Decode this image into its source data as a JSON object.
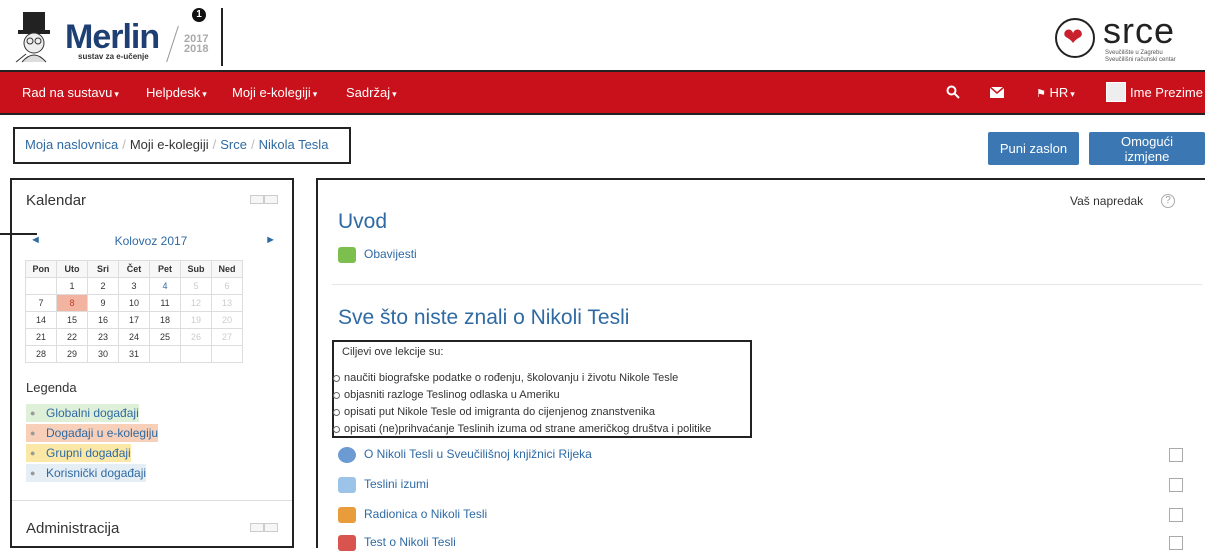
{
  "header": {
    "logo_title": "Merlin",
    "logo_subtitle": "sustav za e-učenje",
    "logo_year": "2017\n2018",
    "badge": "1",
    "partner_name": "srce",
    "partner_sub": "Sveučilište u Zagrebu\nSveučilišni računski centar"
  },
  "navbar": {
    "items": [
      {
        "label": "Rad na sustavu"
      },
      {
        "label": "Helpdesk"
      },
      {
        "label": "Moji e-kolegiji"
      },
      {
        "label": "Sadržaj"
      }
    ],
    "language": "HR",
    "user_name": "Ime Prezime",
    "bg_color": "#c9111b"
  },
  "breadcrumb": {
    "items": [
      "Moja naslovnica",
      "Moji e-kolegiji",
      "Srce",
      "Nikola Tesla"
    ]
  },
  "buttons": {
    "fullscreen": "Puni zaslon",
    "edit": "Omogući izmjene"
  },
  "calendar": {
    "title": "Kalendar",
    "month": "Kolovoz 2017",
    "weekdays": [
      "Pon",
      "Uto",
      "Sri",
      "Čet",
      "Pet",
      "Sub",
      "Ned"
    ],
    "weeks": [
      [
        "",
        "1",
        "2",
        "3",
        "4",
        "5",
        "6"
      ],
      [
        "7",
        "8",
        "9",
        "10",
        "11",
        "12",
        "13"
      ],
      [
        "14",
        "15",
        "16",
        "17",
        "18",
        "19",
        "20"
      ],
      [
        "21",
        "22",
        "23",
        "24",
        "25",
        "26",
        "27"
      ],
      [
        "28",
        "29",
        "30",
        "31",
        "",
        "",
        ""
      ]
    ],
    "today": "8",
    "legend_title": "Legenda",
    "legend": [
      {
        "label": "Globalni događaji",
        "color": "#dff0d8"
      },
      {
        "label": "Događaji u e-kolegiju",
        "color": "#f8cfb8"
      },
      {
        "label": "Grupni događaji",
        "color": "#fbe8a6"
      },
      {
        "label": "Korisnički događaji",
        "color": "#e6eef5"
      }
    ]
  },
  "admin": {
    "title": "Administracija"
  },
  "main": {
    "progress_label": "Vaš napredak",
    "progress_help": "?",
    "section1": {
      "title": "Uvod",
      "activities": [
        {
          "label": "Obavijesti"
        }
      ]
    },
    "section2": {
      "title": "Sve što niste znali o Nikoli Tesli",
      "summary_intro": "Ciljevi ove lekcije su:",
      "summary_items": [
        "naučiti biografske podatke o rođenju, školovanju i životu Nikole Tesle",
        "objasniti razloge Teslinog odlaska u Ameriku",
        "opisati put Nikole Tesle od imigranta do cijenjenog znanstvenika",
        "opisati (ne)prihvaćanje Teslinih izuma od strane američkog društva i politike"
      ],
      "activities": [
        {
          "label": "O Nikoli Tesli u Sveučilišnoj knjižnici Rijeka"
        },
        {
          "label": "Teslini izumi"
        },
        {
          "label": "Radionica o Nikoli Tesli"
        },
        {
          "label": "Test o Nikoli Tesli"
        }
      ]
    }
  }
}
